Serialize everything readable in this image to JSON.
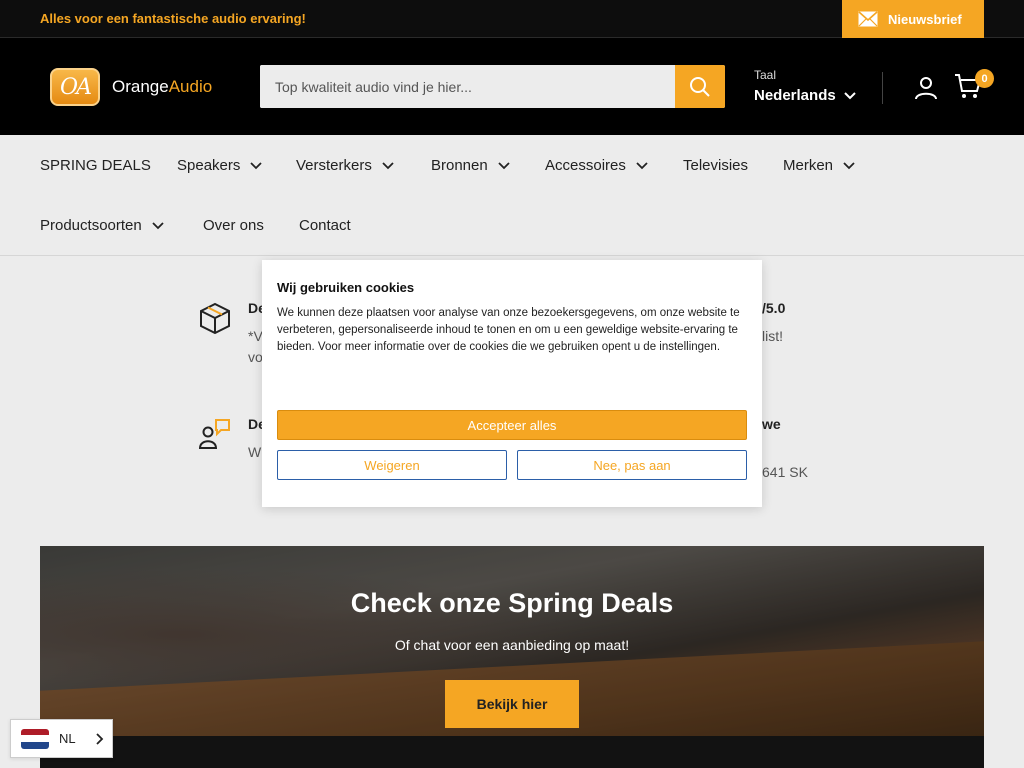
{
  "topbar": {
    "announcement": "Alles voor een fantastische audio ervaring!",
    "newsletter_label": "Nieuwsbrief"
  },
  "header": {
    "logo_text_main": "Orange",
    "logo_text_accent": "Audio",
    "logo_badge": "OA",
    "search_placeholder": "Top kwaliteit audio vind je hier...",
    "language_label": "Taal",
    "language_value": "Nederlands",
    "cart_count": "0"
  },
  "nav": {
    "items": [
      {
        "label": "SPRING DEALS"
      },
      {
        "label": "Speakers"
      },
      {
        "label": "Versterkers"
      },
      {
        "label": "Bronnen"
      },
      {
        "label": "Accessoires"
      },
      {
        "label": "Televisies"
      },
      {
        "label": "Merken"
      },
      {
        "label": "Productsoorten"
      },
      {
        "label": "Over ons"
      },
      {
        "label": "Contact"
      }
    ]
  },
  "features": {
    "f1_title": "De",
    "f1_line1": "*V",
    "f1_line2": "vo",
    "f2_title": "De",
    "f2_line1": "W",
    "f3_title": "/5.0",
    "f3_line1": "list!",
    "f4_title": "we",
    "f4_line1": "641 SK"
  },
  "cookie": {
    "title": "Wij gebruiken cookies",
    "body": "We kunnen deze plaatsen voor analyse van onze bezoekersgegevens, om onze website te verbeteren, gepersonaliseerde inhoud te tonen en om u een geweldige website-ervaring te bieden. Voor meer informatie over de cookies die we gebruiken opent u de instellingen.",
    "accept_label": "Accepteer alles",
    "decline_label": "Weigeren",
    "settings_label": "Nee, pas aan"
  },
  "banner": {
    "title": "Check onze Spring Deals",
    "subtitle": "Of chat voor een aanbieding op maat!",
    "button_label": "Bekijk hier"
  },
  "language_switcher": {
    "code": "NL"
  },
  "colors": {
    "accent": "#f5a623",
    "header_bg": "#000000",
    "page_bg": "#ececec"
  }
}
